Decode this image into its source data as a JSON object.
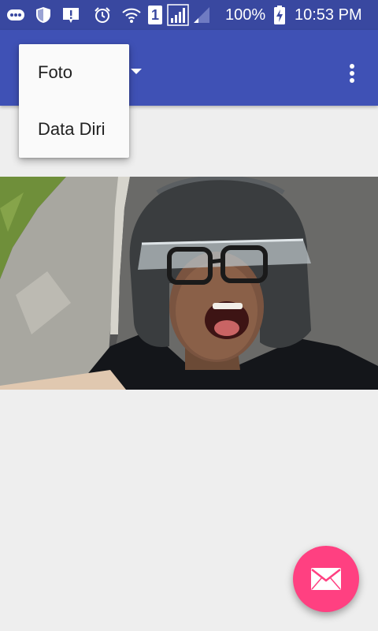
{
  "status_bar": {
    "battery_percent": "100%",
    "time": "10:53 PM",
    "sim_slot": "1",
    "icons": [
      "more-icon",
      "shield-icon",
      "alert-icon",
      "alarm-icon",
      "wifi-icon",
      "sim-1-icon",
      "signal-icon",
      "signal-weak-icon",
      "battery-charging-icon"
    ]
  },
  "app_bar": {
    "color": "#3f51b5",
    "spinner_icon": "dropdown-arrow-icon",
    "overflow_icon": "more-vert-icon"
  },
  "dropdown": {
    "items": [
      {
        "label": "Foto"
      },
      {
        "label": "Data Diri"
      }
    ]
  },
  "photo": {
    "icon": "selfie-photo"
  },
  "fab": {
    "icon": "mail-icon",
    "color": "#ff4081"
  }
}
